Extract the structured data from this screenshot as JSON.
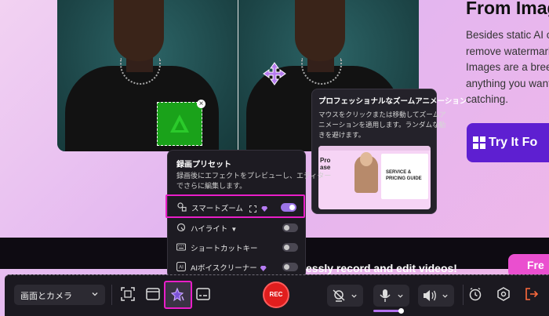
{
  "site": {
    "heading": "From Imag",
    "paragraph_lines": [
      "Besides static AI o",
      "remove watermark",
      "Images are a breez",
      "anything you want",
      "catching."
    ],
    "try_button": "Try It Fo",
    "strip_text": "essly record and edit videos!",
    "pink_button": "Fre"
  },
  "tooltip": {
    "title": "プロフェッショナルなズームアニメーション",
    "desc_lines": [
      "マウスをクリックまたは移動してズームア",
      "ニメーションを適用します。ランダムな動",
      "きを避けます。"
    ],
    "preview": {
      "left_text": "Pro\nase",
      "card_text": "SERVICE &\nPRICING GUIDE"
    }
  },
  "panel": {
    "title": "録画プリセット",
    "desc_lines": [
      "録画後にエフェクトをプレビューし、エディター",
      "でさらに編集します。"
    ],
    "options": [
      {
        "label": "スマートズーム",
        "icon": "smart-zoom-icon",
        "enabled": true,
        "premium": true
      },
      {
        "label": "ハイライト",
        "icon": "highlight-icon",
        "enabled": false,
        "premium": false
      },
      {
        "label": "ショートカットキー",
        "icon": "keyboard-icon",
        "enabled": false,
        "premium": false
      },
      {
        "label": "AIボイスクリーナー",
        "icon": "ai-voice-icon",
        "enabled": false,
        "premium": true
      }
    ]
  },
  "toolbar": {
    "mode": "画面とカメラ",
    "rec_label": "REC",
    "icons": [
      "region-select-icon",
      "window-icon",
      "effects-preset-icon",
      "caption-icon",
      "camera-off-icon",
      "microphone-icon",
      "speaker-icon",
      "timer-icon",
      "settings-icon",
      "exit-icon"
    ]
  },
  "colors": {
    "accent_highlight": "#e91ec8",
    "toggle_on": "#9b74e8",
    "rec_red": "#e01e1e",
    "cta_purple": "#5e1fd1"
  }
}
